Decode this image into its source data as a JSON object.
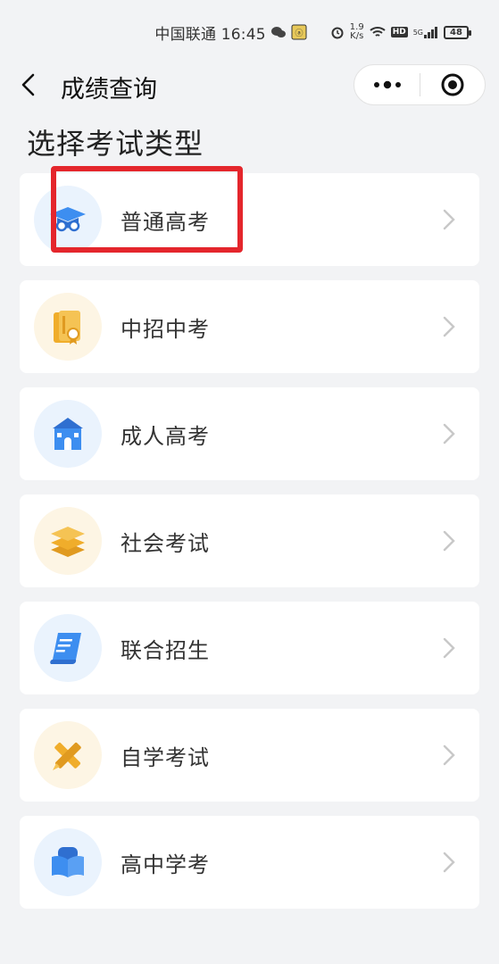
{
  "status": {
    "carrier_time": "中国联通 16:45",
    "speed_value": "1.9",
    "speed_unit": "K/s",
    "hd": "HD",
    "net": "5G",
    "battery": "48"
  },
  "nav": {
    "title": "成绩查询"
  },
  "section_title": "选择考试类型",
  "exam_types": [
    {
      "label": "普通高考",
      "icon": "graduation-cap-icon",
      "tint": "blue"
    },
    {
      "label": "中招中考",
      "icon": "certificate-book-icon",
      "tint": "yellow"
    },
    {
      "label": "成人高考",
      "icon": "school-building-icon",
      "tint": "blue"
    },
    {
      "label": "社会考试",
      "icon": "layers-stack-icon",
      "tint": "yellow"
    },
    {
      "label": "联合招生",
      "icon": "scroll-document-icon",
      "tint": "blue"
    },
    {
      "label": "自学考试",
      "icon": "pencil-ruler-icon",
      "tint": "yellow"
    },
    {
      "label": "高中学考",
      "icon": "open-book-icon",
      "tint": "blue"
    }
  ],
  "colors": {
    "accent_blue": "#3d8ef0",
    "accent_yellow": "#f0ad2b",
    "highlight_red": "#e4262c"
  }
}
